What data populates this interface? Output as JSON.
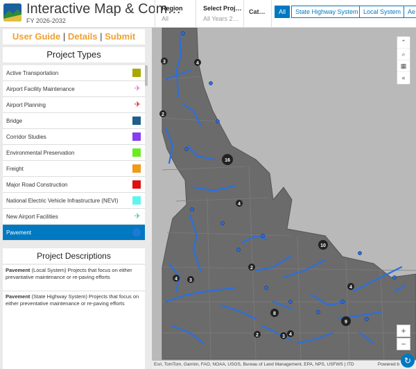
{
  "header": {
    "title": "Interactive Map & Com…",
    "subtitle": "FY 2026-2032",
    "filters": [
      {
        "label": "Region",
        "value": "All"
      },
      {
        "label": "Select Proj…",
        "value": "All Years 2…"
      }
    ],
    "category_label": "Cat…",
    "chips": [
      {
        "label": "All",
        "active": true
      },
      {
        "label": "State Highway System",
        "active": false
      },
      {
        "label": "Local System",
        "active": false
      },
      {
        "label": "Ae",
        "active": false
      }
    ]
  },
  "links": {
    "user_guide": "User Guide",
    "sep1": "|",
    "details": "Details",
    "sep2": "|",
    "submit": "Submit"
  },
  "project_types": {
    "heading": "Project Types",
    "items": [
      {
        "label": "Active Transportation",
        "color": "#a8a800",
        "icon": "square"
      },
      {
        "label": "Airport Facility Maintenance",
        "color": "#e079e0",
        "icon": "airplane-icon"
      },
      {
        "label": "Airport Planning",
        "color": "#e02020",
        "icon": "airplane-icon"
      },
      {
        "label": "Bridge",
        "color": "#1f5f8a",
        "icon": "square"
      },
      {
        "label": "Corridor Studies",
        "color": "#8a3cf0",
        "icon": "square"
      },
      {
        "label": "Environmental Preservation",
        "color": "#6aec23",
        "icon": "square"
      },
      {
        "label": "Freight",
        "color": "#f09a18",
        "icon": "square"
      },
      {
        "label": "Major Road Construction",
        "color": "#e01010",
        "icon": "square"
      },
      {
        "label": "National Electric Vehicle Infrastructure (NEVI)",
        "color": "#5ef5f0",
        "icon": "square"
      },
      {
        "label": "New Airport Facilities",
        "color": "#58c0a8",
        "icon": "airplane-icon"
      },
      {
        "label": "Pavement",
        "color": "#1f78d8",
        "icon": "circle",
        "active": true
      }
    ]
  },
  "project_descriptions": {
    "heading": "Project Descriptions",
    "items": [
      {
        "name": "Pavement",
        "text": "(Local System)  Projects that focus on either prevantative maintenance or re-paving efforts"
      },
      {
        "name": "Pavement",
        "text": "(State Highway System)  Projects that focus on either preventative maintenance or re-paving efforts"
      }
    ]
  },
  "map": {
    "attribution": "Esri, TomTom, Garmin, FAO, NOAA, USGS, Bureau of Land Management, EPA, NPS, USFWS | ITD",
    "powered_by": "Powered b",
    "tools": [
      "expand-icon",
      "search-icon",
      "qr-icon",
      "collapse-icon"
    ],
    "cluster_labels": [
      "4",
      "3",
      "2",
      "16",
      "4",
      "10",
      "2",
      "4",
      "4",
      "3",
      "8",
      "4",
      "9",
      "2",
      "3"
    ],
    "colors": {
      "state": "#6b6b6b",
      "roads": "#2a6fe0",
      "bg": "#b9b9b9"
    }
  }
}
